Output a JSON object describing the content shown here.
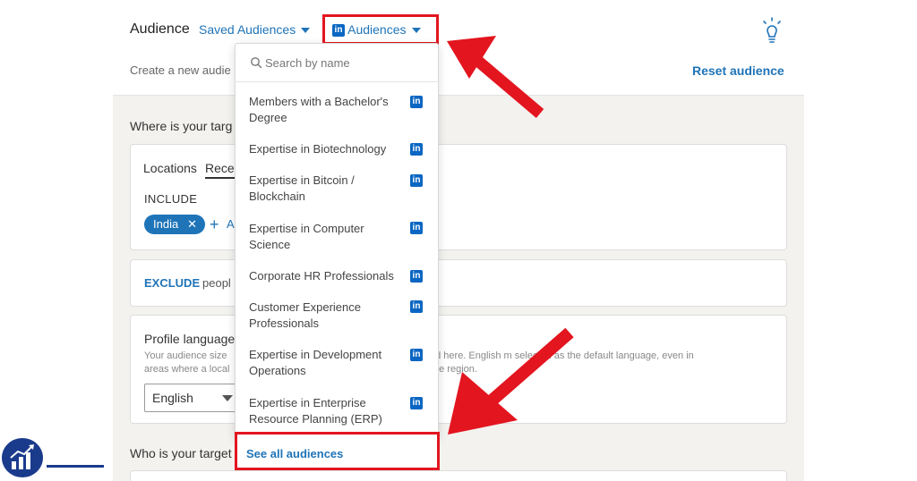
{
  "header": {
    "title": "Audience",
    "saved_audiences": "Saved Audiences",
    "audiences": "Audiences",
    "linkedin_badge": "in",
    "create_text": "Create a new audie",
    "reset": "Reset audience"
  },
  "targeting": {
    "where_heading": "Where is your targ",
    "locations_label": "Locations",
    "recent_tab": "Recen",
    "include_label": "INCLUDE",
    "location_pill": "India",
    "pill_remove": "✕",
    "add_icon": "+",
    "add_text": "A",
    "exclude_label": "EXCLUDE",
    "exclude_text": "peopl",
    "profile_language_label": "Profile language",
    "size_line1": "Your audience size",
    "size_line2": "areas where a local",
    "right_line1": "ed here. English m    selected as the default language, even in",
    "right_line2": "he region.",
    "language_select": "English",
    "who_heading": "Who is your target"
  },
  "dropdown": {
    "search_placeholder": "Search by name",
    "items": [
      {
        "line1": "Members with a Bachelor's",
        "line2": "Degree"
      },
      {
        "line1": "Expertise in Biotechnology",
        "line2": ""
      },
      {
        "line1": "Expertise in Bitcoin /",
        "line2": "Blockchain"
      },
      {
        "line1": "Expertise in Computer",
        "line2": "Science"
      },
      {
        "line1": "Corporate HR Professionals",
        "line2": ""
      },
      {
        "line1": "Customer Experience",
        "line2": "Professionals"
      },
      {
        "line1": "Expertise in Development",
        "line2": "Operations"
      },
      {
        "line1": "Expertise in Enterprise",
        "line2": "Resource Planning (ERP)"
      }
    ],
    "see_all": "See all audiences"
  },
  "colors": {
    "link_blue": "#1f74b8",
    "highlight_red": "#e3151f",
    "linkedin_blue": "#0a66c2"
  },
  "icons": [
    "lightbulb-icon",
    "search-icon",
    "linkedin-icon",
    "chevron-down-icon",
    "close-icon",
    "plus-icon",
    "arrow-annotation",
    "logo-chart-icon"
  ]
}
